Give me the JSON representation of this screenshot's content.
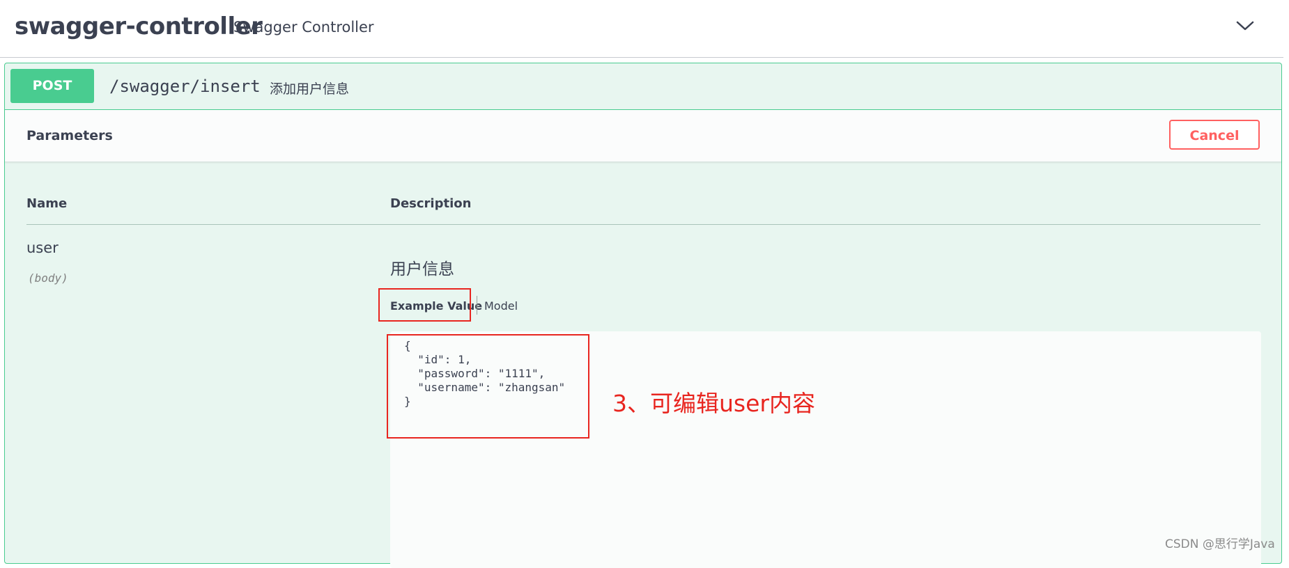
{
  "tag": {
    "name": "swagger-controller",
    "description": "Swagger Controller",
    "toggle_icon": "chevron-down-icon"
  },
  "operation": {
    "method": "POST",
    "path": "/swagger/insert",
    "summary": "添加用户信息",
    "color": "#49cc90"
  },
  "parameters_section": {
    "title": "Parameters",
    "cancel_label": "Cancel",
    "cancel_color": "#ff6060",
    "columns": {
      "name": "Name",
      "description": "Description"
    },
    "params": [
      {
        "name": "user",
        "in": "(body)",
        "description": "用户信息",
        "tabs": {
          "example": "Example Value",
          "model": "Model"
        },
        "example_value": "{\n  \"id\": 1,\n  \"password\": \"1111\",\n  \"username\": \"zhangsan\"\n}"
      }
    ]
  },
  "annotation": {
    "text": "3、可编辑user内容",
    "color": "#e8251f"
  },
  "watermark": "CSDN @思行学Java"
}
